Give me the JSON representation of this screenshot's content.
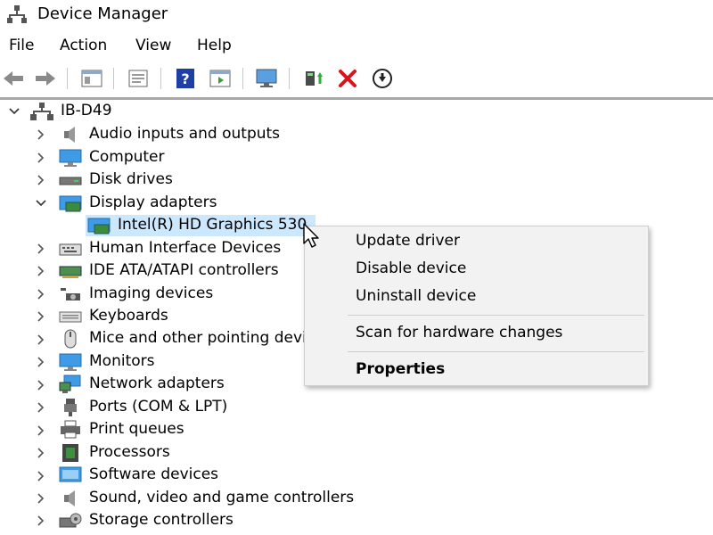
{
  "window": {
    "title": "Device Manager"
  },
  "menu": {
    "items": [
      "File",
      "Action",
      "View",
      "Help"
    ]
  },
  "toolbar": {
    "buttons": [
      "back-arrow-icon",
      "forward-arrow-icon",
      "show-hide-console-icon",
      "properties-sheet-icon",
      "help-icon",
      "action-pane-icon",
      "monitor-scan-icon",
      "update-driver-icon",
      "uninstall-x-icon",
      "download-icon"
    ],
    "accent": "#1f5fbf",
    "danger": "#d9141c"
  },
  "tree": {
    "root": "IB-D49",
    "categories": [
      "Audio inputs and outputs",
      "Computer",
      "Disk drives",
      "Display adapters",
      "Human Interface Devices",
      "IDE ATA/ATAPI controllers",
      "Imaging devices",
      "Keyboards",
      "Mice and other pointing devices",
      "Monitors",
      "Network adapters",
      "Ports (COM & LPT)",
      "Print queues",
      "Processors",
      "Software devices",
      "Sound, video and game controllers",
      "Storage controllers"
    ],
    "selected_child": "Intel(R) HD Graphics 530",
    "selection_color": "#cce8ff"
  },
  "context_menu": {
    "items": [
      "Update driver",
      "Disable device",
      "Uninstall device",
      "Scan for hardware changes",
      "Properties"
    ]
  }
}
